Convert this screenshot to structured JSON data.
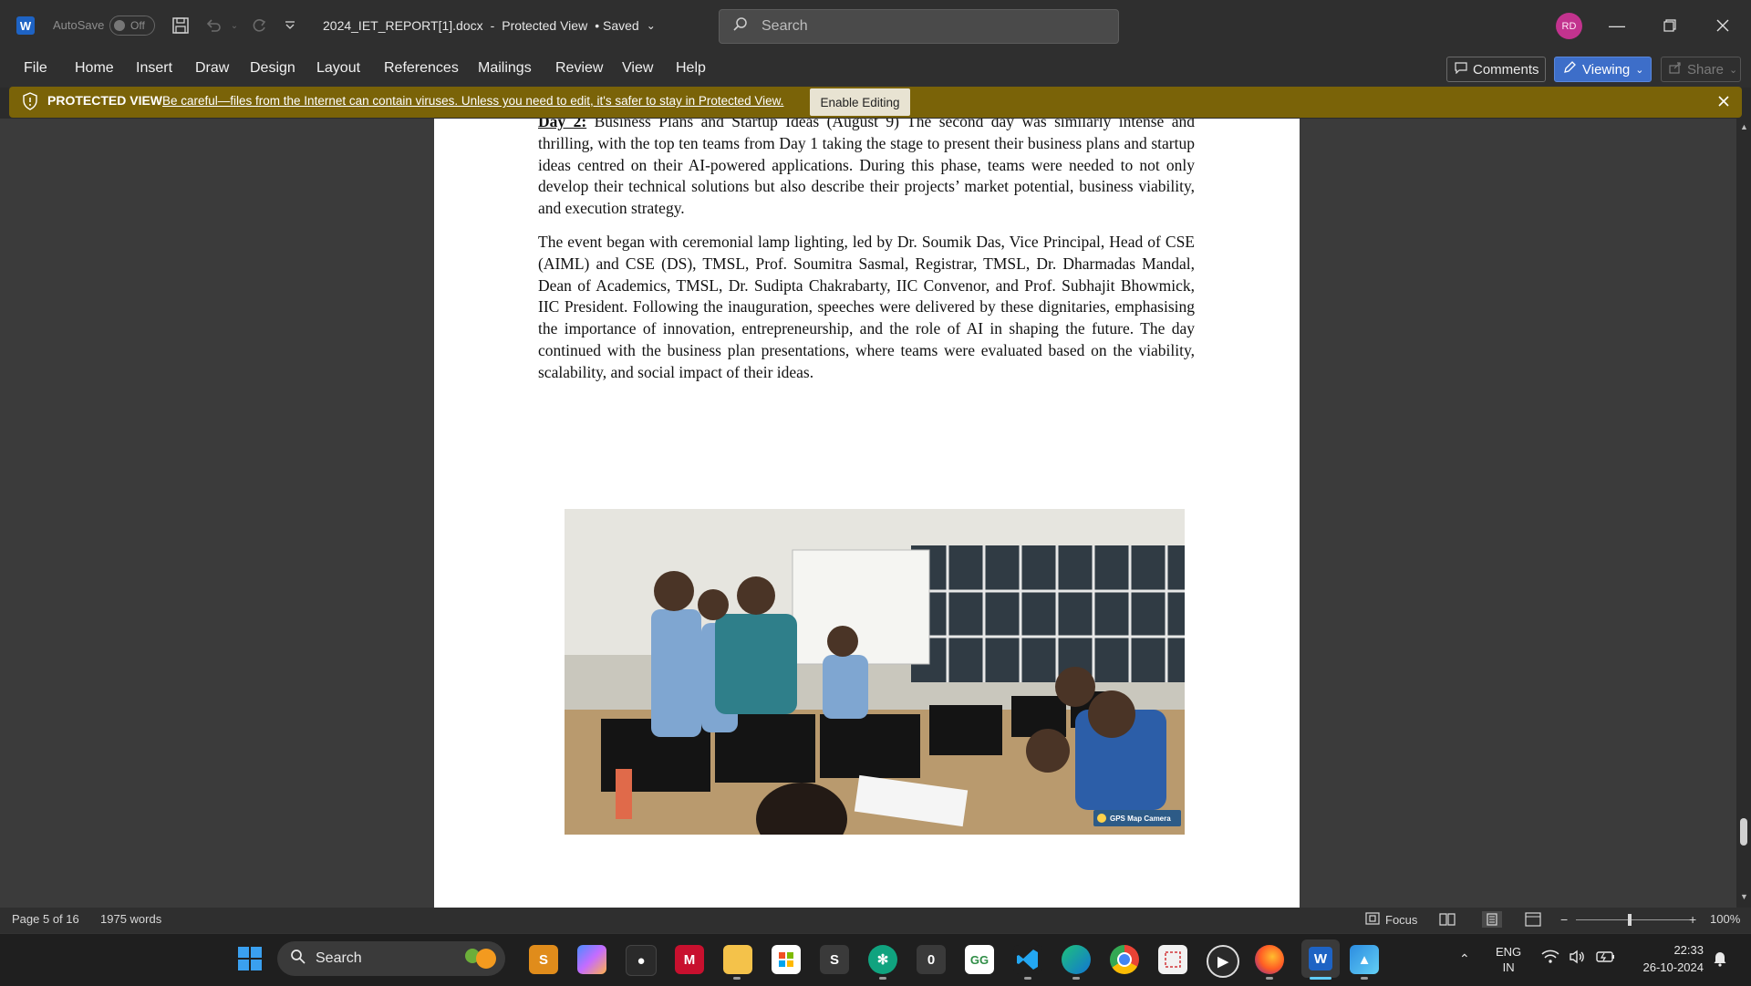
{
  "titlebar": {
    "autosave_label": "AutoSave",
    "autosave_state": "Off",
    "filename": "2024_IET_REPORT[1].docx",
    "separator": "-",
    "view_mode": "Protected View",
    "save_status": "• Saved",
    "search_placeholder": "Search",
    "avatar_initials": "RD"
  },
  "ribbon": {
    "tabs": [
      "File",
      "Home",
      "Insert",
      "Draw",
      "Design",
      "Layout",
      "References",
      "Mailings",
      "Review",
      "View",
      "Help"
    ],
    "comments_label": "Comments",
    "viewing_label": "Viewing",
    "share_label": "Share"
  },
  "protected_view": {
    "label": "PROTECTED VIEW",
    "message": "Be careful—files from the Internet can contain viruses. Unless you need to edit, it's safer to stay in Protected View.",
    "enable_button": "Enable Editing"
  },
  "document": {
    "para1_heading": "Day 2:",
    "para1_body": " Business Plans and Startup Ideas (August 9) The second day was similarly intense and thrilling, with the top ten teams from Day 1 taking the stage to present their business plans and startup ideas centred on their AI-powered applications. During this phase, teams were needed to not only develop their technical solutions but also describe their projects’ market potential, business viability, and execution strategy.",
    "para2": "The event began with ceremonial lamp lighting, led by Dr. Soumik Das, Vice Principal, Head of CSE (AIML) and CSE (DS), TMSL, Prof. Soumitra Sasmal, Registrar, TMSL, Dr. Dharmadas Mandal, Dean of Academics, TMSL, Dr. Sudipta Chakrabarty, IIC Convenor, and Prof. Subhajit Bhowmick, IIC President. Following the inauguration, speeches were delivered by these dignitaries, emphasising the importance of innovation, entrepreneurship, and the role of AI in shaping the future. The day continued with the business plan presentations, where teams were evaluated based on the viability, scalability, and social impact of their ideas.",
    "photo_watermark": "GPS Map Camera"
  },
  "statusbar": {
    "page": "Page 5 of 16",
    "words": "1975 words",
    "focus_label": "Focus",
    "zoom": "100%"
  },
  "taskbar": {
    "search_label": "Search",
    "lang_line1": "ENG",
    "lang_line2": "IN",
    "time": "22:33",
    "date": "26-10-2024",
    "badge_s": "S",
    "badge_0": "0"
  },
  "colors": {
    "protected_bar": "#7a6308",
    "word_blue": "#1e63c4",
    "avatar": "#c2338e",
    "viewing_btn": "#3d6ec9"
  }
}
